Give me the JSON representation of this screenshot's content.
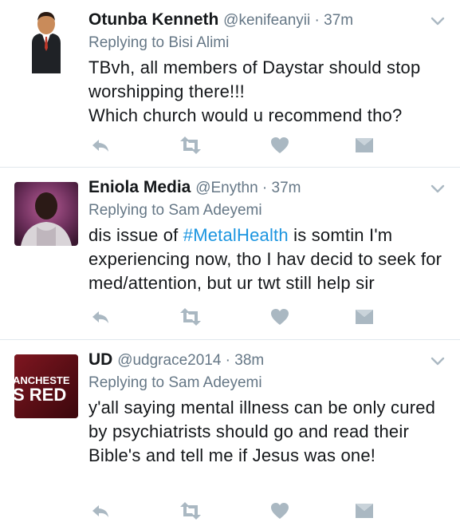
{
  "tweets": [
    {
      "name": "Otunba Kenneth",
      "handle": "@kenifeanyii",
      "sep": " · ",
      "time": "37m",
      "reply_prefix": "Replying to ",
      "reply_to": "Bisi Alimi",
      "text_before": "TBvh,  all members of Daystar should stop worshipping there!!!\nWhich church would u recommend tho?",
      "hashtag": "",
      "text_after": "",
      "avatar_icon": "cartoon-man-suit-avatar"
    },
    {
      "name": "Eniola Media",
      "handle": "@Enythn",
      "sep": " · ",
      "time": "37m",
      "reply_prefix": "Replying to ",
      "reply_to": "Sam Adeyemi",
      "text_before": "dis issue of ",
      "hashtag": "#MetalHealth",
      "text_after": " is somtin  I'm experiencing now, tho I hav decid to seek for med/attention, but ur twt still help sir",
      "avatar_icon": "photo-avatar"
    },
    {
      "name": "UD",
      "handle": "@udgrace2014",
      "sep": " · ",
      "time": "38m",
      "reply_prefix": "Replying to ",
      "reply_to": "Sam Adeyemi",
      "text_before": "y'all saying mental illness can be only cured by psychiatrists should go and read their Bible's and tell me if Jesus was one!",
      "hashtag": "",
      "text_after": "",
      "avatar_icon": "manchester-reds-banner-avatar",
      "avatar_text_1": "ANCHESTE",
      "avatar_text_2": "S RED"
    }
  ],
  "icons": [
    "reply-icon",
    "retweet-icon",
    "like-icon",
    "direct-message-icon",
    "chevron-down-icon"
  ],
  "colors": {
    "text": "#14171a",
    "secondary": "#657786",
    "hashtag": "#1b95e0",
    "icon": "#aab8c2",
    "divider": "#e1e8ed"
  }
}
